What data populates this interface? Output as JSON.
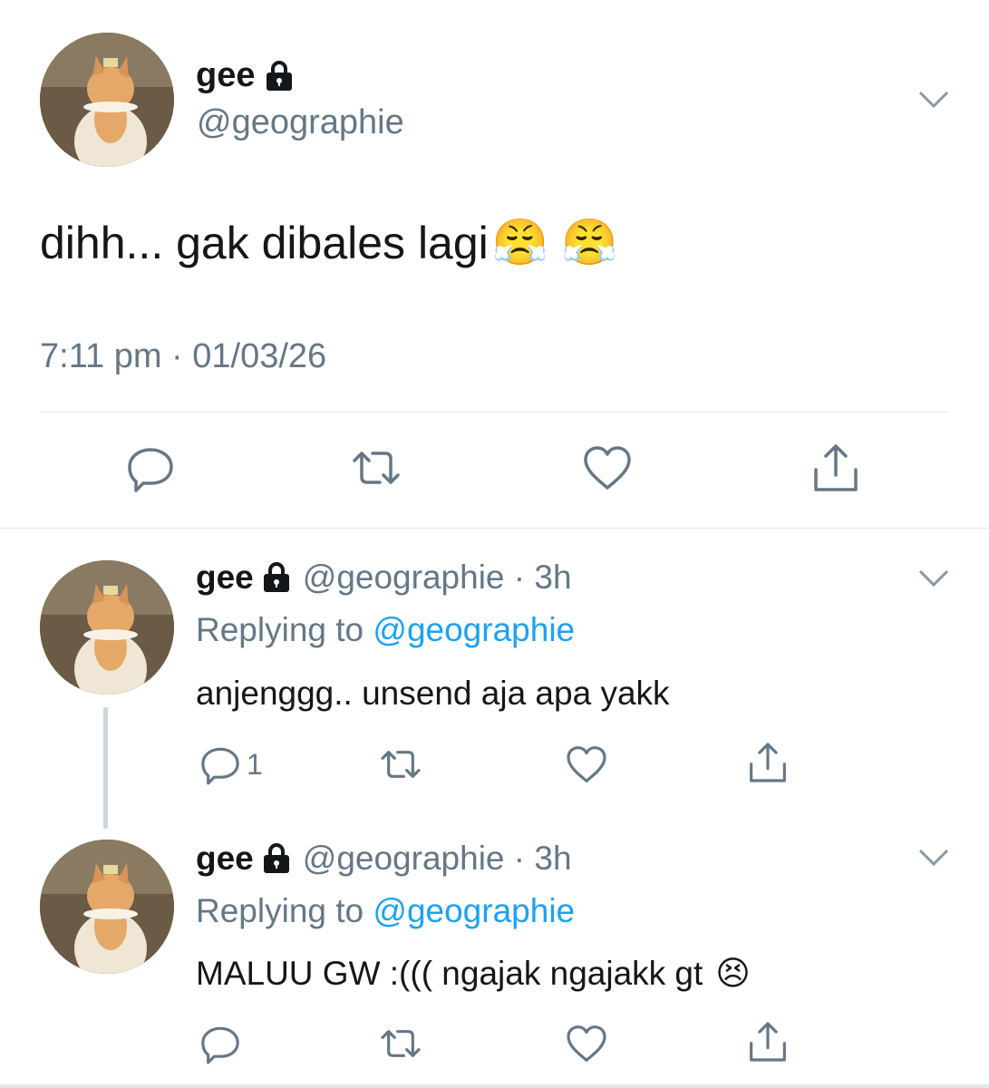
{
  "main_tweet": {
    "name": "gee",
    "handle": "@geographie",
    "text": "dihh... gak dibales lagi",
    "emoji": [
      "😤",
      "😤"
    ],
    "time": "7:11 pm · 01/03/26",
    "actions": [
      "reply-icon",
      "retweet-icon",
      "like-icon",
      "share-icon"
    ]
  },
  "replies": [
    {
      "name": "gee",
      "handle": "@geographie",
      "time": "3h",
      "replying_prefix": "Replying to",
      "replying_to": "@geographie",
      "text": "anjenggg.. unsend aja apa yakk",
      "emoji": "",
      "reply_count": "1"
    },
    {
      "name": "gee",
      "handle": "@geographie",
      "time": "3h",
      "replying_prefix": "Replying to",
      "replying_to": "@geographie",
      "text": "MALUU GW :((( ngajak ngajakk gt",
      "emoji": "😣",
      "reply_count": ""
    }
  ],
  "colors": {
    "text": "#14171a",
    "secondary": "#657786",
    "link": "#1da1f2",
    "divider": "#e1e8ed"
  }
}
